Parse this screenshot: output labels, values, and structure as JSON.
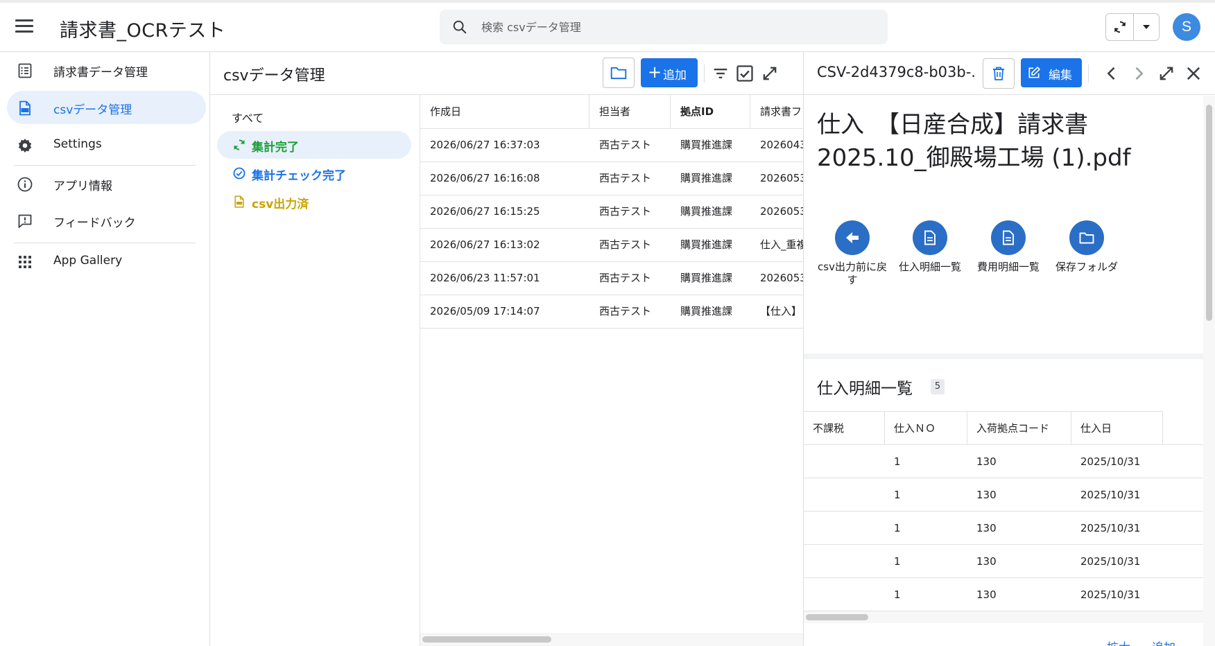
{
  "app": {
    "title": "請求書_OCRテスト",
    "search_placeholder": "検索 csvデータ管理",
    "avatar_letter": "S"
  },
  "colors": {
    "accent": "#1a73e8",
    "nav_active_bg": "#e8f0fb",
    "status_done": "#1e9e3a",
    "status_checked": "#1a73e8",
    "status_exported": "#c9a400",
    "action_circle": "#2a6ec6",
    "avatar": "#3d8ae0"
  },
  "sidebar": {
    "items": [
      {
        "label": "請求書データ管理",
        "icon": "list-doc-icon"
      },
      {
        "label": "csvデータ管理",
        "icon": "csv-file-icon"
      },
      {
        "label": "Settings",
        "icon": "gear-icon"
      },
      {
        "label": "アプリ情報",
        "icon": "info-icon"
      },
      {
        "label": "フィードバック",
        "icon": "feedback-icon"
      },
      {
        "label": "App Gallery",
        "icon": "apps-grid-icon"
      }
    ]
  },
  "list_panel": {
    "title": "csvデータ管理",
    "add_label": "追加"
  },
  "filters": {
    "all_label": "すべて",
    "items": [
      {
        "label": "集計完了",
        "icon": "sync-icon"
      },
      {
        "label": "集計チェック完了",
        "icon": "check-circle-icon"
      },
      {
        "label": "csv出力済",
        "icon": "csv-file-icon"
      }
    ]
  },
  "table": {
    "columns": [
      "作成日",
      "担当者",
      "拠点ID",
      "請求書フ"
    ],
    "rows": [
      [
        "2026/06/27 16:37:03",
        "西古テスト",
        "購買推進課",
        "2026043"
      ],
      [
        "2026/06/27 16:16:08",
        "西古テスト",
        "購買推進課",
        "2026053"
      ],
      [
        "2026/06/27 16:15:25",
        "西古テスト",
        "購買推進課",
        "2026053"
      ],
      [
        "2026/06/27 16:13:02",
        "西古テスト",
        "購買推進課",
        "仕入_重複"
      ],
      [
        "2026/06/23 11:57:01",
        "西古テスト",
        "購買推進課",
        "2026053"
      ],
      [
        "2026/05/09 17:14:07",
        "西古テスト",
        "購買推進課",
        "【仕入】"
      ]
    ]
  },
  "detail": {
    "id": "CSV-2d4379c8-b03b-...",
    "edit_label": "編集",
    "doc_title": "仕入　【日産合成】請求書2025.10_御殿場工場 (1).pdf",
    "actions": [
      {
        "label": "csv出力前に戻す",
        "icon": "arrow-left-icon"
      },
      {
        "label": "仕入明細一覧",
        "icon": "document-icon"
      },
      {
        "label": "費用明細一覧",
        "icon": "document-icon"
      },
      {
        "label": "保存フォルダ",
        "icon": "folder-icon"
      }
    ],
    "section_title": "仕入明細一覧",
    "section_count": "5",
    "columns": [
      "不課税",
      "仕入ＮＯ",
      "入荷拠点コード",
      "仕入日"
    ],
    "rows": [
      [
        "",
        "1",
        "130",
        "2025/10/31"
      ],
      [
        "",
        "1",
        "130",
        "2025/10/31"
      ],
      [
        "",
        "1",
        "130",
        "2025/10/31"
      ],
      [
        "",
        "1",
        "130",
        "2025/10/31"
      ],
      [
        "",
        "1",
        "130",
        "2025/10/31"
      ]
    ],
    "footer_links": [
      "拡大",
      "追加"
    ]
  }
}
